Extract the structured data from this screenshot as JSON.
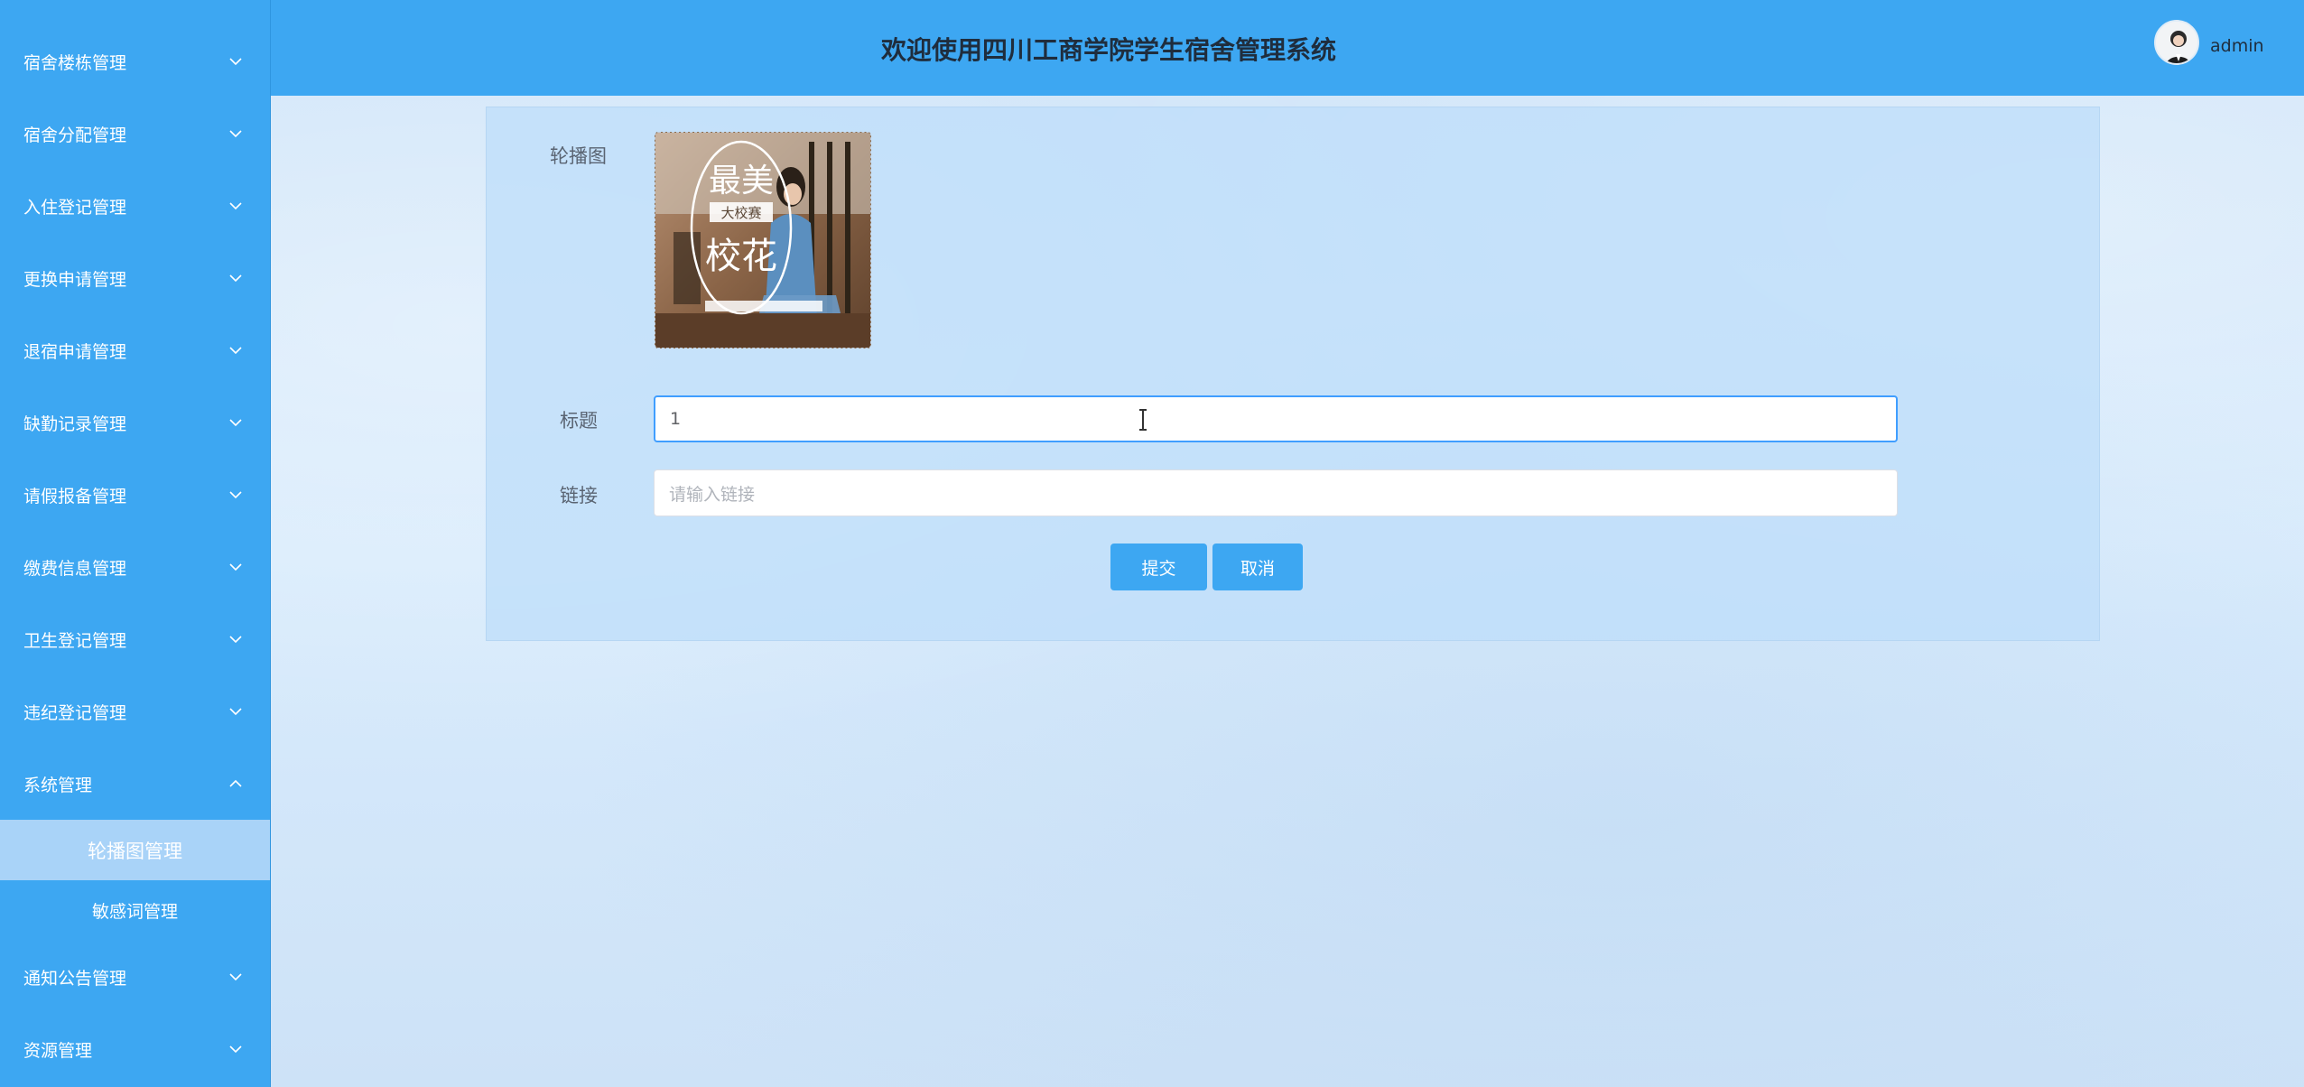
{
  "header": {
    "title": "欢迎使用四川工商学院学生宿舍管理系统",
    "username": "admin"
  },
  "sidebar": {
    "items": [
      {
        "label": "宿舍楼栋管理",
        "expanded": false
      },
      {
        "label": "宿舍分配管理",
        "expanded": false
      },
      {
        "label": "入住登记管理",
        "expanded": false
      },
      {
        "label": "更换申请管理",
        "expanded": false
      },
      {
        "label": "退宿申请管理",
        "expanded": false
      },
      {
        "label": "缺勤记录管理",
        "expanded": false
      },
      {
        "label": "请假报备管理",
        "expanded": false
      },
      {
        "label": "缴费信息管理",
        "expanded": false
      },
      {
        "label": "卫生登记管理",
        "expanded": false
      },
      {
        "label": "违纪登记管理",
        "expanded": false
      },
      {
        "label": "系统管理",
        "expanded": true
      },
      {
        "label": "通知公告管理",
        "expanded": false
      },
      {
        "label": "资源管理",
        "expanded": false
      }
    ],
    "submenu": [
      {
        "label": "轮播图管理",
        "active": true
      },
      {
        "label": "敏感词管理",
        "active": false
      }
    ]
  },
  "form": {
    "banner_label": "轮播图",
    "banner_text": {
      "top": "最美",
      "middle": "大校赛",
      "bottom": "校花"
    },
    "title_label": "标题",
    "title_value": "1",
    "link_label": "链接",
    "link_placeholder": "请输入链接",
    "submit_label": "提交",
    "cancel_label": "取消"
  },
  "colors": {
    "accent": "#3da7f2",
    "active_submenu": "#a9d3f8",
    "focus_border": "#409eff"
  }
}
